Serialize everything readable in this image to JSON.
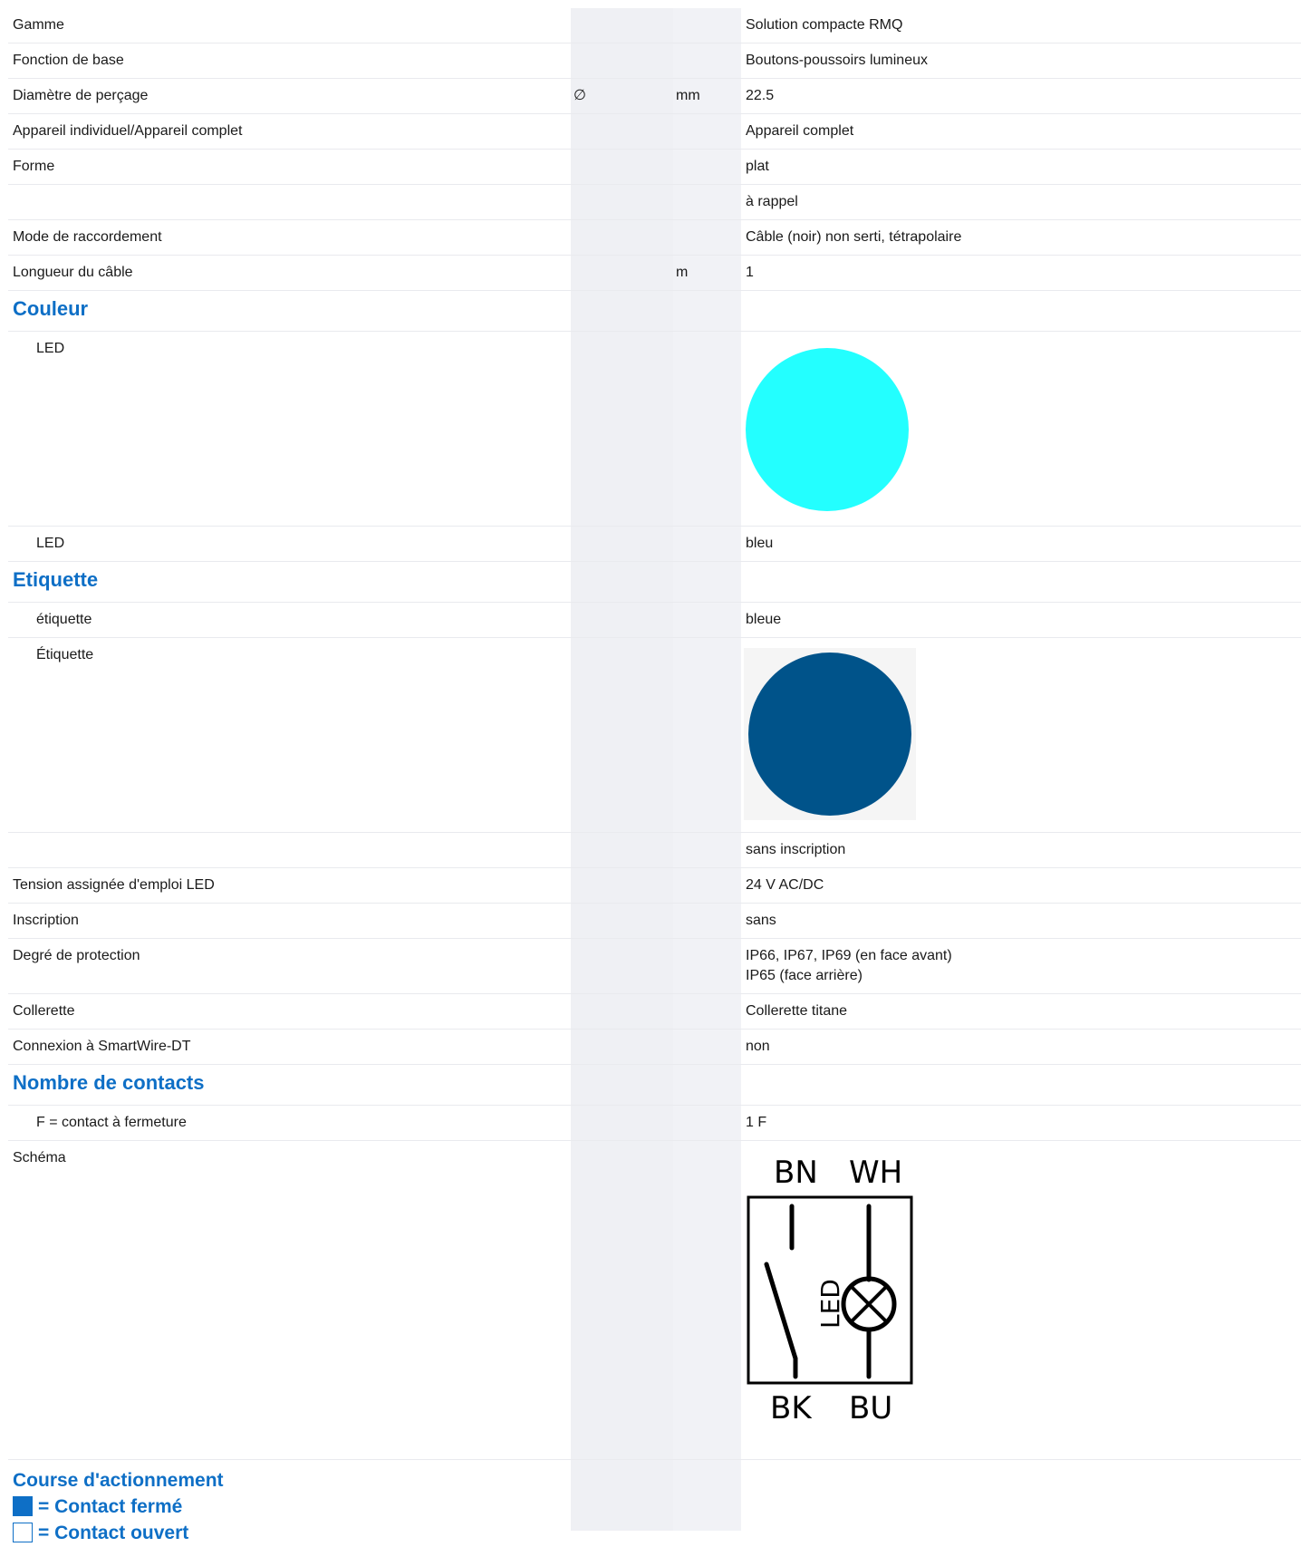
{
  "rows": [
    {
      "label": "Gamme",
      "sym": "",
      "unit": "",
      "value": "Solution compacte RMQ"
    },
    {
      "label": "Fonction de base",
      "sym": "",
      "unit": "",
      "value": "Boutons-poussoirs lumineux"
    },
    {
      "label": "Diamètre de perçage",
      "sym": "∅",
      "unit": "mm",
      "value": "22.5"
    },
    {
      "label": "Appareil individuel/Appareil complet",
      "sym": "",
      "unit": "",
      "value": "Appareil complet"
    },
    {
      "label": "Forme",
      "sym": "",
      "unit": "",
      "value": "plat"
    },
    {
      "label": "",
      "sym": "",
      "unit": "",
      "value": "à rappel"
    },
    {
      "label": "Mode de raccordement",
      "sym": "",
      "unit": "",
      "value": "Câble (noir) non serti, tétrapolaire"
    },
    {
      "label": "Longueur du câble",
      "sym": "",
      "unit": "m",
      "value": "1"
    }
  ],
  "couleur": {
    "title": "Couleur",
    "led_label_1": "LED",
    "led_swatch_color": "#23ffff",
    "led_label_2": "LED",
    "led_value": "bleu"
  },
  "etiquette": {
    "title": "Etiquette",
    "label_1": "étiquette",
    "value_1": "bleue",
    "label_2": "Étiquette",
    "swatch_color": "#00538a",
    "value_3": "sans inscription"
  },
  "rows2": [
    {
      "label": "Tension assignée d'emploi LED",
      "value": "24 V AC/DC"
    },
    {
      "label": "Inscription",
      "value": "sans"
    },
    {
      "label": "Degré de protection",
      "value": "IP66, IP67, IP69 (en face avant)",
      "value2": "IP65 (face arrière)"
    },
    {
      "label": "Collerette",
      "value": "Collerette titane"
    },
    {
      "label": "Connexion à SmartWire-DT",
      "value": "non"
    }
  ],
  "contacts": {
    "title": "Nombre de contacts",
    "label": "F = contact à fermeture",
    "value": "1 F"
  },
  "schema": {
    "label": "Schéma",
    "top_left": "BN",
    "top_right": "WH",
    "bottom_left": "BK",
    "bottom_right": "BU",
    "led": "LED"
  },
  "course": {
    "title": "Course d'actionnement",
    "closed": "= Contact fermé",
    "open": "= Contact ouvert"
  }
}
